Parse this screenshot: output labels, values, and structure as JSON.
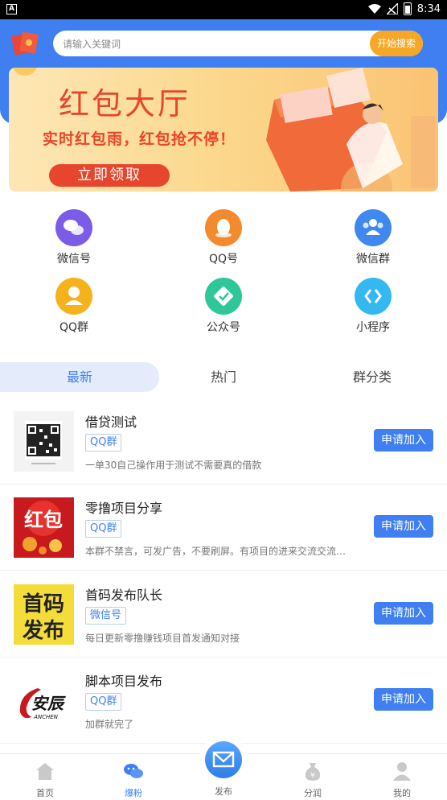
{
  "status_bar": {
    "time": "8:34"
  },
  "search": {
    "placeholder": "请输入关键词",
    "button": "开始搜索"
  },
  "banner": {
    "title": "红包大厅",
    "subtitle": "实时红包雨，红包抢不停！",
    "cta": "立即领取"
  },
  "categories": [
    {
      "label": "微信号",
      "icon": "wechat-icon",
      "color": "#7b5ce8"
    },
    {
      "label": "QQ号",
      "icon": "qq-icon",
      "color": "#f28a2e"
    },
    {
      "label": "微信群",
      "icon": "group-icon",
      "color": "#3f88f0"
    },
    {
      "label": "QQ群",
      "icon": "qq-group-icon",
      "color": "#f5b21c"
    },
    {
      "label": "公众号",
      "icon": "official-account-icon",
      "color": "#2fc69a"
    },
    {
      "label": "小程序",
      "icon": "mini-program-icon",
      "color": "#34b8f0"
    }
  ],
  "tabs": [
    "最新",
    "热门",
    "群分类"
  ],
  "list": [
    {
      "name": "借贷测试",
      "tag": "QQ群",
      "desc": "一单30自己操作用于测试不需要真的借款",
      "join": "申请加入"
    },
    {
      "name": "零撸项目分享",
      "tag": "QQ群",
      "desc": "本群不禁言，可发广告，不要刷屏。有项目的进来交流交流…",
      "join": "申请加入"
    },
    {
      "name": "首码发布队长",
      "tag": "微信号",
      "desc": "每日更新零撸赚钱项目首发通知对接",
      "join": "申请加入"
    },
    {
      "name": "脚本项目发布",
      "tag": "QQ群",
      "desc": "加群就完了",
      "join": "申请加入"
    }
  ],
  "thumbs": {
    "hongbao": "红包",
    "shouma_1": "首码",
    "shouma_2": "发布",
    "anchen": "安辰",
    "anchen_en": "ANCHEN"
  },
  "nav": [
    {
      "label": "首页",
      "icon": "home-icon"
    },
    {
      "label": "爆粉",
      "icon": "chat-icon"
    },
    {
      "label": "发布",
      "icon": "mail-icon"
    },
    {
      "label": "分润",
      "icon": "money-bag-icon"
    },
    {
      "label": "我的",
      "icon": "user-icon"
    }
  ],
  "colors": {
    "primary": "#3f7ff2",
    "accent": "#f7a726",
    "banner_red": "#e7452c"
  }
}
